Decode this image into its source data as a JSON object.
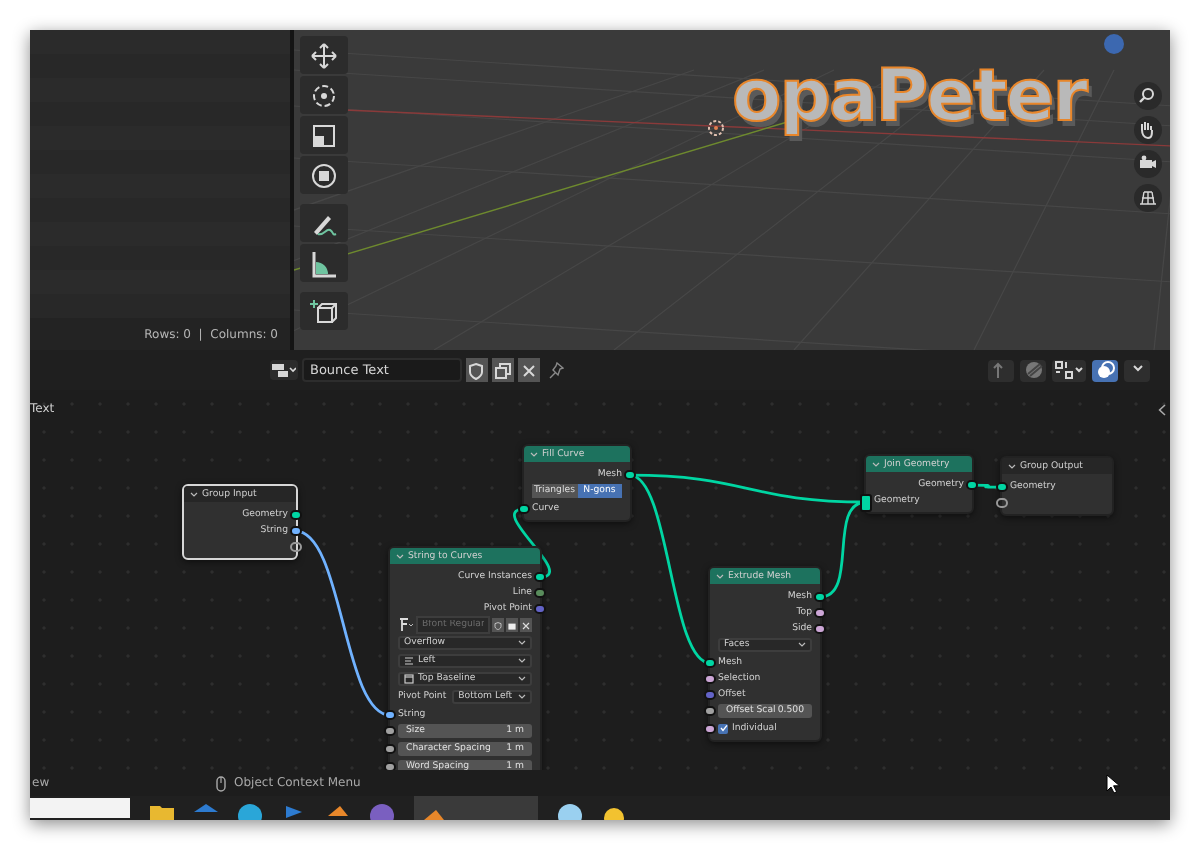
{
  "spreadsheet": {
    "footer": "Rows: 0  |  Columns: 0"
  },
  "viewport": {
    "object_text": "opaPeter"
  },
  "node_header": {
    "tree_name": "Bounce Text"
  },
  "node_editor": {
    "sidebar_tab": "Text",
    "nodes": [
      {
        "title": "Group Input",
        "kind": "group",
        "selected": true,
        "rows": [
          {
            "kind": "output",
            "label": "Geometry",
            "color": "#00d6a3"
          },
          {
            "kind": "output",
            "label": "String",
            "color": "#70b2ff"
          },
          {
            "kind": "empty_output"
          }
        ]
      },
      {
        "title": "String to Curves",
        "kind": "geometry",
        "selected": false,
        "rows": [
          {
            "kind": "output",
            "label": "Curve Instances",
            "color": "#00d6a3"
          },
          {
            "kind": "output",
            "label": "Line",
            "color": "#598c5c"
          },
          {
            "kind": "output",
            "label": "Pivot Point",
            "color": "#6363c7"
          },
          {
            "kind": "font",
            "placeholder": "Bfont Regular"
          },
          {
            "kind": "dropdown",
            "value": "Overflow"
          },
          {
            "kind": "dropdown_icon",
            "value": "Left"
          },
          {
            "kind": "dropdown_icon",
            "value": "Top Baseline"
          },
          {
            "kind": "labeled_dropdown",
            "label": "Pivot Point",
            "value": "Bottom Left"
          },
          {
            "kind": "input",
            "label": "String",
            "color": "#70b2ff"
          },
          {
            "kind": "field",
            "label": "Size",
            "value": "1 m",
            "color": "#a1a1a1"
          },
          {
            "kind": "field",
            "label": "Character Spacing",
            "value": "1 m",
            "color": "#a1a1a1"
          },
          {
            "kind": "field",
            "label": "Word Spacing",
            "value": "1 m",
            "color": "#a1a1a1"
          }
        ]
      },
      {
        "title": "Fill Curve",
        "kind": "geometry",
        "selected": false,
        "rows": [
          {
            "kind": "output",
            "label": "Mesh",
            "color": "#00d6a3"
          },
          {
            "kind": "toggle",
            "options": [
              {
                "label": "Triangles",
                "selected": false
              },
              {
                "label": "N-gons",
                "selected": true
              }
            ]
          },
          {
            "kind": "input",
            "label": "Curve",
            "color": "#00d6a3"
          }
        ]
      },
      {
        "title": "Extrude Mesh",
        "kind": "geometry",
        "selected": false,
        "rows": [
          {
            "kind": "output",
            "label": "Mesh",
            "color": "#00d6a3"
          },
          {
            "kind": "output",
            "label": "Top",
            "color": "#cca6d6"
          },
          {
            "kind": "output",
            "label": "Side",
            "color": "#cca6d6"
          },
          {
            "kind": "dropdown",
            "value": "Faces"
          },
          {
            "kind": "input",
            "label": "Mesh",
            "color": "#00d6a3"
          },
          {
            "kind": "input",
            "label": "Selection",
            "color": "#cca6d6"
          },
          {
            "kind": "input",
            "label": "Offset",
            "color": "#6363c7"
          },
          {
            "kind": "field",
            "label": "Offset Scal",
            "value": "0.500",
            "color": "#a1a1a1"
          },
          {
            "kind": "checkbox",
            "label": "Individual",
            "checked": true,
            "color": "#cca6d6"
          }
        ]
      },
      {
        "title": "Join Geometry",
        "kind": "geometry",
        "selected": false,
        "rows": [
          {
            "kind": "output",
            "label": "Geometry",
            "color": "#00d6a3"
          },
          {
            "kind": "multi_input",
            "label": "Geometry",
            "color": "#00d6a3"
          }
        ]
      },
      {
        "title": "Group Output",
        "kind": "group",
        "selected": false,
        "rows": [
          {
            "kind": "input",
            "label": "Geometry",
            "color": "#00d6a3"
          },
          {
            "kind": "empty_input"
          }
        ]
      }
    ]
  },
  "status_bar": {
    "left": "ew",
    "hint": "Object Context Menu"
  }
}
